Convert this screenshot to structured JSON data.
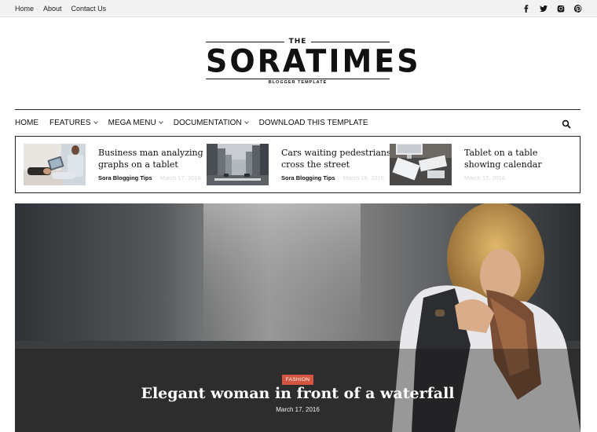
{
  "topbar": {
    "links": [
      "Home",
      "About",
      "Contact Us"
    ],
    "social": [
      "facebook-icon",
      "twitter-icon",
      "instagram-icon",
      "pinterest-icon"
    ]
  },
  "logo": {
    "the": "THE",
    "main": "SORATIMES",
    "sub": "BLOGGER TEMPLATE"
  },
  "nav": {
    "items": [
      {
        "label": "HOME",
        "dropdown": false
      },
      {
        "label": "FEATURES",
        "dropdown": true
      },
      {
        "label": "MEGA MENU",
        "dropdown": true
      },
      {
        "label": "DOCUMENTATION",
        "dropdown": true
      },
      {
        "label": "DOWNLOAD THIS TEMPLATE",
        "dropdown": false
      }
    ],
    "search_icon": "search-icon"
  },
  "featured": [
    {
      "title": "Business man analyzing graphs on a tablet",
      "author": "Sora Blogging Tips",
      "date": "March 17, 2016"
    },
    {
      "title": "Cars waiting pedestrians cross the street",
      "author": "Sora Blogging Tips",
      "date": "March 16, 2016"
    },
    {
      "title": "Tablet on a table showing calendar",
      "author": "",
      "date": "March 15, 2016"
    }
  ],
  "hero": {
    "category": "FASHION",
    "title": "Elegant woman in front of a waterfall",
    "date": "March 17, 2016"
  },
  "colors": {
    "accent": "#d35440",
    "text": "#111111",
    "topbar_bg": "#f2f2f2"
  }
}
